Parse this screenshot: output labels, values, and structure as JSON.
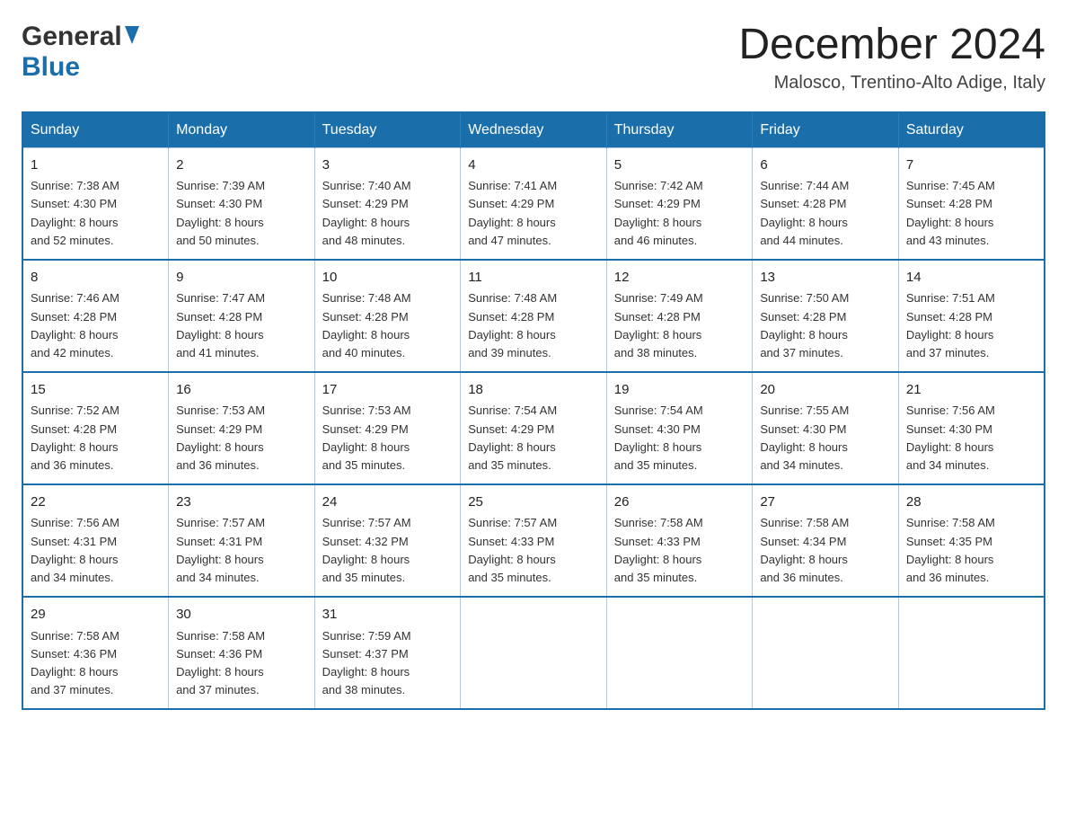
{
  "logo": {
    "general_text": "General",
    "blue_text": "Blue"
  },
  "title": {
    "month_year": "December 2024",
    "location": "Malosco, Trentino-Alto Adige, Italy"
  },
  "columns": [
    "Sunday",
    "Monday",
    "Tuesday",
    "Wednesday",
    "Thursday",
    "Friday",
    "Saturday"
  ],
  "weeks": [
    [
      {
        "day": "1",
        "info": "Sunrise: 7:38 AM\nSunset: 4:30 PM\nDaylight: 8 hours\nand 52 minutes."
      },
      {
        "day": "2",
        "info": "Sunrise: 7:39 AM\nSunset: 4:30 PM\nDaylight: 8 hours\nand 50 minutes."
      },
      {
        "day": "3",
        "info": "Sunrise: 7:40 AM\nSunset: 4:29 PM\nDaylight: 8 hours\nand 48 minutes."
      },
      {
        "day": "4",
        "info": "Sunrise: 7:41 AM\nSunset: 4:29 PM\nDaylight: 8 hours\nand 47 minutes."
      },
      {
        "day": "5",
        "info": "Sunrise: 7:42 AM\nSunset: 4:29 PM\nDaylight: 8 hours\nand 46 minutes."
      },
      {
        "day": "6",
        "info": "Sunrise: 7:44 AM\nSunset: 4:28 PM\nDaylight: 8 hours\nand 44 minutes."
      },
      {
        "day": "7",
        "info": "Sunrise: 7:45 AM\nSunset: 4:28 PM\nDaylight: 8 hours\nand 43 minutes."
      }
    ],
    [
      {
        "day": "8",
        "info": "Sunrise: 7:46 AM\nSunset: 4:28 PM\nDaylight: 8 hours\nand 42 minutes."
      },
      {
        "day": "9",
        "info": "Sunrise: 7:47 AM\nSunset: 4:28 PM\nDaylight: 8 hours\nand 41 minutes."
      },
      {
        "day": "10",
        "info": "Sunrise: 7:48 AM\nSunset: 4:28 PM\nDaylight: 8 hours\nand 40 minutes."
      },
      {
        "day": "11",
        "info": "Sunrise: 7:48 AM\nSunset: 4:28 PM\nDaylight: 8 hours\nand 39 minutes."
      },
      {
        "day": "12",
        "info": "Sunrise: 7:49 AM\nSunset: 4:28 PM\nDaylight: 8 hours\nand 38 minutes."
      },
      {
        "day": "13",
        "info": "Sunrise: 7:50 AM\nSunset: 4:28 PM\nDaylight: 8 hours\nand 37 minutes."
      },
      {
        "day": "14",
        "info": "Sunrise: 7:51 AM\nSunset: 4:28 PM\nDaylight: 8 hours\nand 37 minutes."
      }
    ],
    [
      {
        "day": "15",
        "info": "Sunrise: 7:52 AM\nSunset: 4:28 PM\nDaylight: 8 hours\nand 36 minutes."
      },
      {
        "day": "16",
        "info": "Sunrise: 7:53 AM\nSunset: 4:29 PM\nDaylight: 8 hours\nand 36 minutes."
      },
      {
        "day": "17",
        "info": "Sunrise: 7:53 AM\nSunset: 4:29 PM\nDaylight: 8 hours\nand 35 minutes."
      },
      {
        "day": "18",
        "info": "Sunrise: 7:54 AM\nSunset: 4:29 PM\nDaylight: 8 hours\nand 35 minutes."
      },
      {
        "day": "19",
        "info": "Sunrise: 7:54 AM\nSunset: 4:30 PM\nDaylight: 8 hours\nand 35 minutes."
      },
      {
        "day": "20",
        "info": "Sunrise: 7:55 AM\nSunset: 4:30 PM\nDaylight: 8 hours\nand 34 minutes."
      },
      {
        "day": "21",
        "info": "Sunrise: 7:56 AM\nSunset: 4:30 PM\nDaylight: 8 hours\nand 34 minutes."
      }
    ],
    [
      {
        "day": "22",
        "info": "Sunrise: 7:56 AM\nSunset: 4:31 PM\nDaylight: 8 hours\nand 34 minutes."
      },
      {
        "day": "23",
        "info": "Sunrise: 7:57 AM\nSunset: 4:31 PM\nDaylight: 8 hours\nand 34 minutes."
      },
      {
        "day": "24",
        "info": "Sunrise: 7:57 AM\nSunset: 4:32 PM\nDaylight: 8 hours\nand 35 minutes."
      },
      {
        "day": "25",
        "info": "Sunrise: 7:57 AM\nSunset: 4:33 PM\nDaylight: 8 hours\nand 35 minutes."
      },
      {
        "day": "26",
        "info": "Sunrise: 7:58 AM\nSunset: 4:33 PM\nDaylight: 8 hours\nand 35 minutes."
      },
      {
        "day": "27",
        "info": "Sunrise: 7:58 AM\nSunset: 4:34 PM\nDaylight: 8 hours\nand 36 minutes."
      },
      {
        "day": "28",
        "info": "Sunrise: 7:58 AM\nSunset: 4:35 PM\nDaylight: 8 hours\nand 36 minutes."
      }
    ],
    [
      {
        "day": "29",
        "info": "Sunrise: 7:58 AM\nSunset: 4:36 PM\nDaylight: 8 hours\nand 37 minutes."
      },
      {
        "day": "30",
        "info": "Sunrise: 7:58 AM\nSunset: 4:36 PM\nDaylight: 8 hours\nand 37 minutes."
      },
      {
        "day": "31",
        "info": "Sunrise: 7:59 AM\nSunset: 4:37 PM\nDaylight: 8 hours\nand 38 minutes."
      },
      null,
      null,
      null,
      null
    ]
  ]
}
